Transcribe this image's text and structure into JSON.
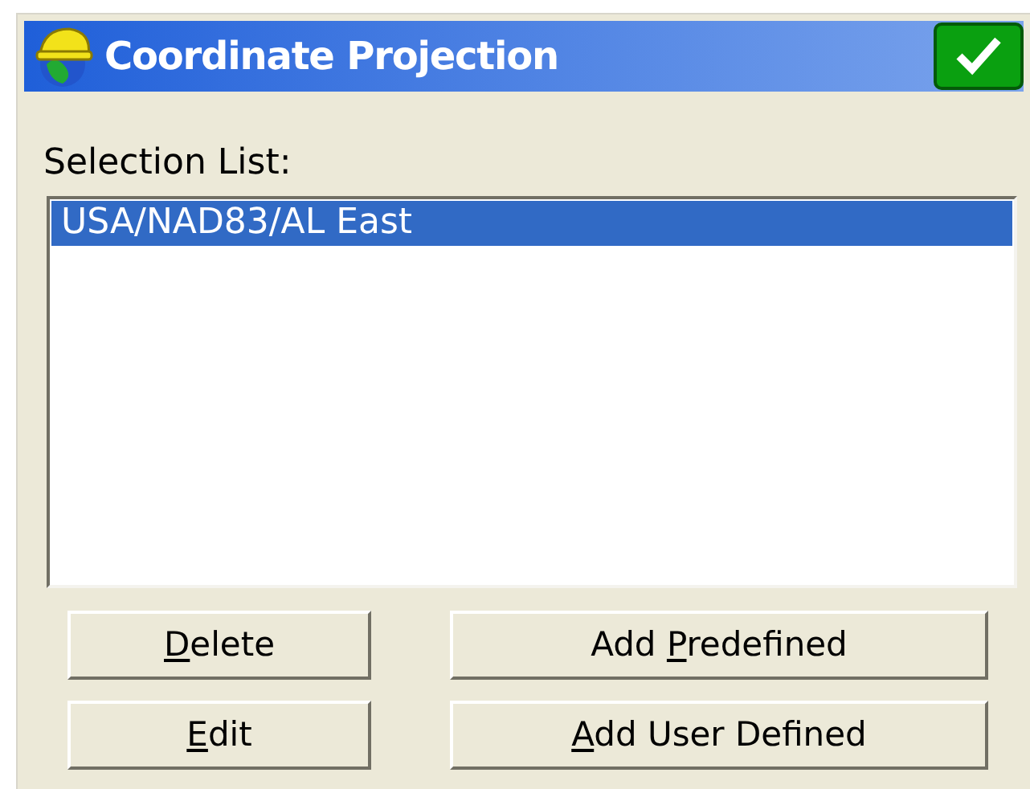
{
  "window": {
    "title": "Coordinate Projection"
  },
  "list": {
    "label": "Selection List:",
    "items": [
      {
        "text": "USA/NAD83/AL East",
        "selected": true
      }
    ]
  },
  "buttons": [
    {
      "key": "D",
      "after": "elete"
    },
    {
      "before": "Add ",
      "key": "P",
      "after": "redefined"
    },
    {
      "key": "E",
      "after": "dit"
    },
    {
      "key": "A",
      "after": "dd User Defined"
    }
  ]
}
